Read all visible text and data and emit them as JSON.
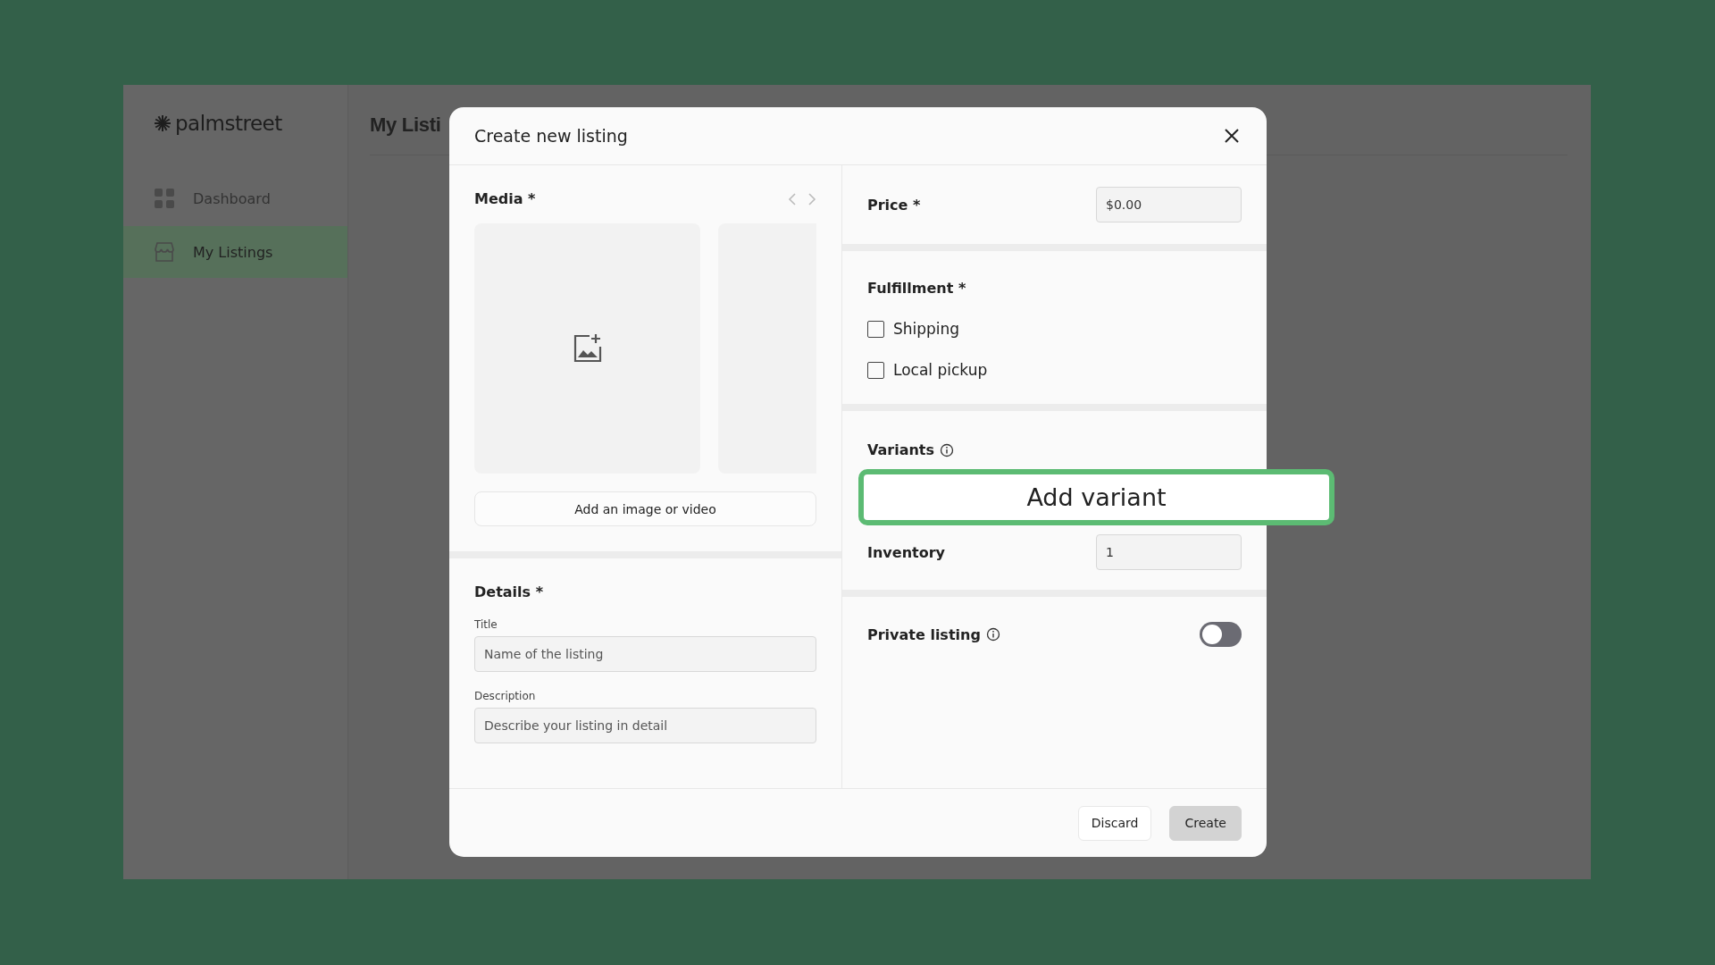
{
  "brand": {
    "name": "palmstreet"
  },
  "sidebar": {
    "items": [
      {
        "label": "Dashboard",
        "kind": "grid",
        "selected": false
      },
      {
        "label": "My Listings",
        "kind": "store",
        "selected": true
      }
    ]
  },
  "page": {
    "title": "My Listi"
  },
  "modal": {
    "title": "Create new listing",
    "media": {
      "heading": "Media *",
      "add_button": "Add an image or video"
    },
    "details": {
      "heading": "Details *",
      "fields": [
        {
          "label": "Title",
          "placeholder": "Name of the listing"
        },
        {
          "label": "Description",
          "placeholder": "Describe your listing in detail"
        }
      ]
    },
    "price": {
      "label": "Price *",
      "value": "$0.00"
    },
    "fulfillment": {
      "heading": "Fulfillment *",
      "options": [
        {
          "label": "Shipping",
          "checked": false
        },
        {
          "label": "Local pickup",
          "checked": false
        }
      ]
    },
    "variants": {
      "heading": "Variants",
      "add_button": "Add variant"
    },
    "inventory": {
      "label": "Inventory",
      "value": "1"
    },
    "private": {
      "label": "Private listing",
      "on": false
    },
    "buttons": [
      {
        "label": "Discard",
        "kind": "secondary"
      },
      {
        "label": "Create",
        "kind": "primary"
      }
    ]
  }
}
